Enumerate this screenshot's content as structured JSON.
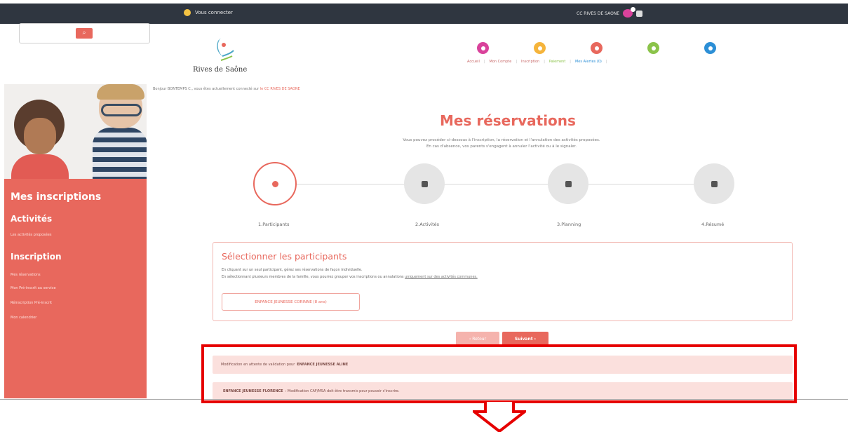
{
  "topbar": {
    "connect_label": "Vous connecter",
    "user_label": "CC RIVES DE SAONE"
  },
  "header": {
    "logo_text": "Rives de Saône",
    "nav": [
      {
        "label": "Accueil",
        "color": "#d9429b"
      },
      {
        "label": "Mon Compte",
        "color": "#f5b43b"
      },
      {
        "label": "Inscription",
        "color": "#e8685d"
      },
      {
        "label": "Paiement",
        "color": "#8bc34a"
      },
      {
        "label": "Mes Alertes (0)",
        "color": "#2c8fd6"
      }
    ]
  },
  "welcome": {
    "text": "Bonjour BONTEMPS C., vous êtes actuellement connecté sur",
    "site": "le CC RIVES DE SAONE"
  },
  "sidebar": {
    "title": "Mes inscriptions",
    "section1": {
      "heading": "Activités",
      "links": [
        "Les activités proposées"
      ]
    },
    "section2": {
      "heading": "Inscription",
      "links": [
        "Mes réservations",
        "Mon Pré-inscrit au service",
        "Réinscription Pré-inscrit",
        "Mon calendrier"
      ]
    }
  },
  "main": {
    "title": "Mes réservations",
    "intro_line1": "Vous pouvez procéder ci-dessous à l'inscription, la réservation et l'annulation des activités proposées.",
    "intro_line2": "En cas d'absence, vos parents s'engagent à annuler l'activité ou à le signaler."
  },
  "steps": [
    {
      "label": "1.Participants",
      "icon": "users-icon",
      "active": true
    },
    {
      "label": "2.Activités",
      "icon": "book-icon",
      "active": false
    },
    {
      "label": "3.Planning",
      "icon": "calendar-icon",
      "active": false
    },
    {
      "label": "4.Résumé",
      "icon": "check-square-icon",
      "active": false
    }
  ],
  "panel": {
    "title": "Sélectionner les participants",
    "line1": "En cliquant sur un seul participant, gérez ses réservations de façon individuelle.",
    "line2": "En sélectionnant plusieurs membres de la famille, vous pourrez grouper vos inscriptions ou annulations",
    "line2_link": "uniquement sur des activités communes.",
    "participant": "ENFANCE JEUNESSE CORINNE (8 ans)"
  },
  "buttons": {
    "prev": "‹ Retour",
    "next": "Suivant ›"
  },
  "notifications": [
    {
      "prefix": "Modification en attente de validation pour",
      "name": "ENFANCE JEUNESSE ALINE",
      "suffix": ""
    },
    {
      "prefix": "",
      "name": "ENFANCE JEUNESSE FLORENCE",
      "suffix": ": Modification CAF/MSA doit être transmis pour pouvoir s'inscrire."
    }
  ]
}
